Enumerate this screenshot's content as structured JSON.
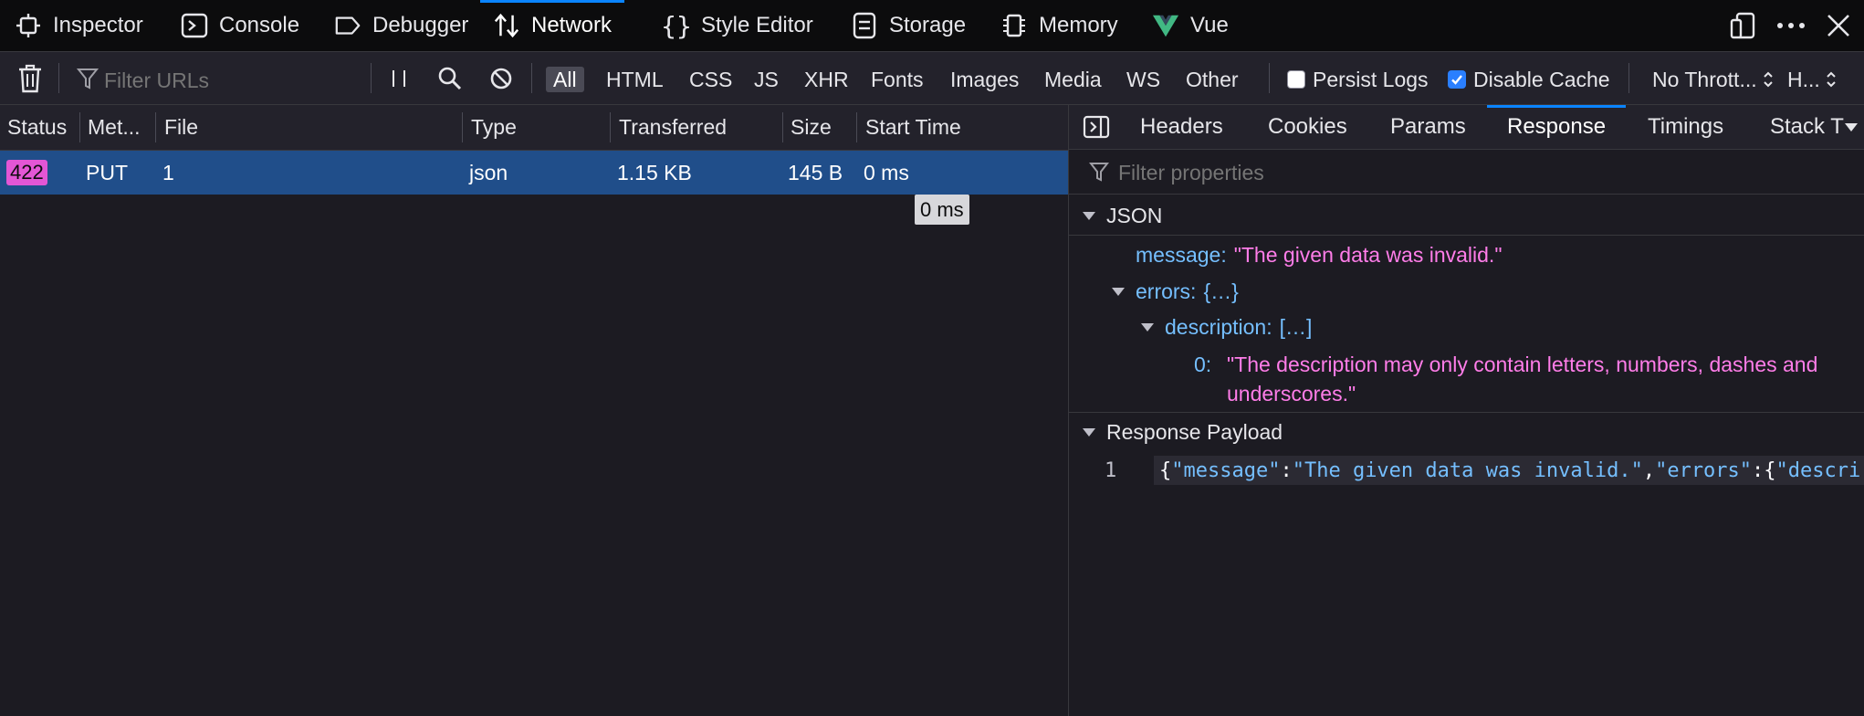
{
  "tabs": [
    {
      "label": "Inspector",
      "icon": "inspector-icon"
    },
    {
      "label": "Console",
      "icon": "console-icon"
    },
    {
      "label": "Debugger",
      "icon": "debugger-icon"
    },
    {
      "label": "Network",
      "icon": "network-icon",
      "selected": true
    },
    {
      "label": "Style Editor",
      "icon": "style-editor-icon"
    },
    {
      "label": "Storage",
      "icon": "storage-icon"
    },
    {
      "label": "Memory",
      "icon": "memory-icon"
    },
    {
      "label": "Vue",
      "icon": "vue-icon"
    }
  ],
  "toolbar": {
    "filter_placeholder": "Filter URLs",
    "filters": [
      "All",
      "HTML",
      "CSS",
      "JS",
      "XHR",
      "Fonts",
      "Images",
      "Media",
      "WS",
      "Other"
    ],
    "selected_filter": "All",
    "persist_logs": {
      "label": "Persist Logs",
      "checked": false
    },
    "disable_cache": {
      "label": "Disable Cache",
      "checked": true
    },
    "throttling": "No Thrott...",
    "har": "H..."
  },
  "columns": [
    "Status",
    "Met...",
    "File",
    "Type",
    "Transferred",
    "Size",
    "Start Time"
  ],
  "request": {
    "status": "422",
    "method": "PUT",
    "file": "1",
    "type": "json",
    "transferred": "1.15 KB",
    "size": "145 B",
    "start_time": "0 ms",
    "tooltip": "0 ms"
  },
  "details": {
    "tabs": [
      "Headers",
      "Cookies",
      "Params",
      "Response",
      "Timings",
      "Stack T"
    ],
    "selected_tab": "Response",
    "filter_placeholder": "Filter properties",
    "json_section": "JSON",
    "json": {
      "message_key": "message:",
      "message_value": "\"The given data was invalid.\"",
      "errors_key": "errors:",
      "errors_summary": "{…}",
      "description_key": "description:",
      "description_summary": "[…]",
      "item_index": "0:",
      "item_value_line1": "\"The description may only contain letters, numbers, dashes and",
      "item_value_line2": "underscores.\""
    },
    "payload_section": "Response Payload",
    "payload_line_number": "1",
    "payload": {
      "brace": "{",
      "k1": "\"message\"",
      "colon1": ":",
      "v1": "\"The given data was invalid.\"",
      "comma": ",",
      "k2": "\"errors\"",
      "colon2": ":{",
      "k3": "\"descri"
    }
  },
  "colors": {
    "accent": "#0a84ff",
    "selected_row": "#204e8a",
    "status_badge": "#e356d5",
    "json_key": "#75bfff",
    "json_string": "#ff7de9"
  }
}
